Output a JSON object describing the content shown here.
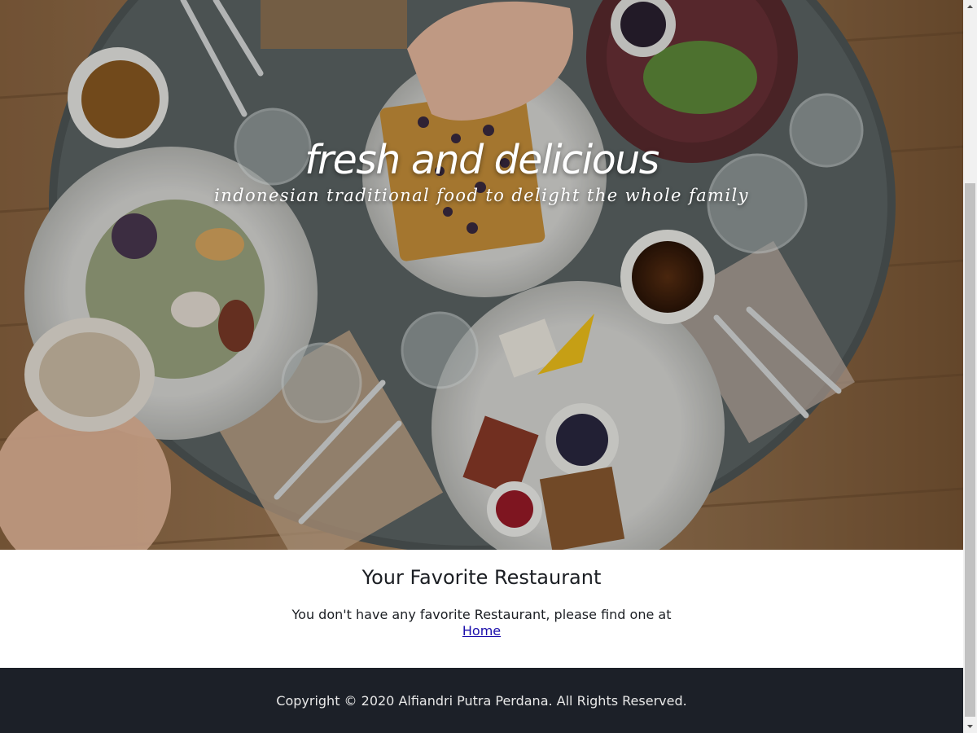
{
  "hero": {
    "title": "fresh and delicious",
    "tagline": "indonesian traditional food to delight the whole family",
    "image": "overhead-breakfast-table-photo"
  },
  "favorites": {
    "heading": "Your Favorite Restaurant",
    "empty_message": "You don't have any favorite Restaurant, please find one at",
    "home_link": "Home"
  },
  "footer": {
    "copyright": "Copyright © 2020 Alfiandri Putra Perdana. All Rights Reserved."
  },
  "colors": {
    "footer_bg": "#1c2028",
    "link": "#1a0dab",
    "text": "#1b1e23"
  }
}
